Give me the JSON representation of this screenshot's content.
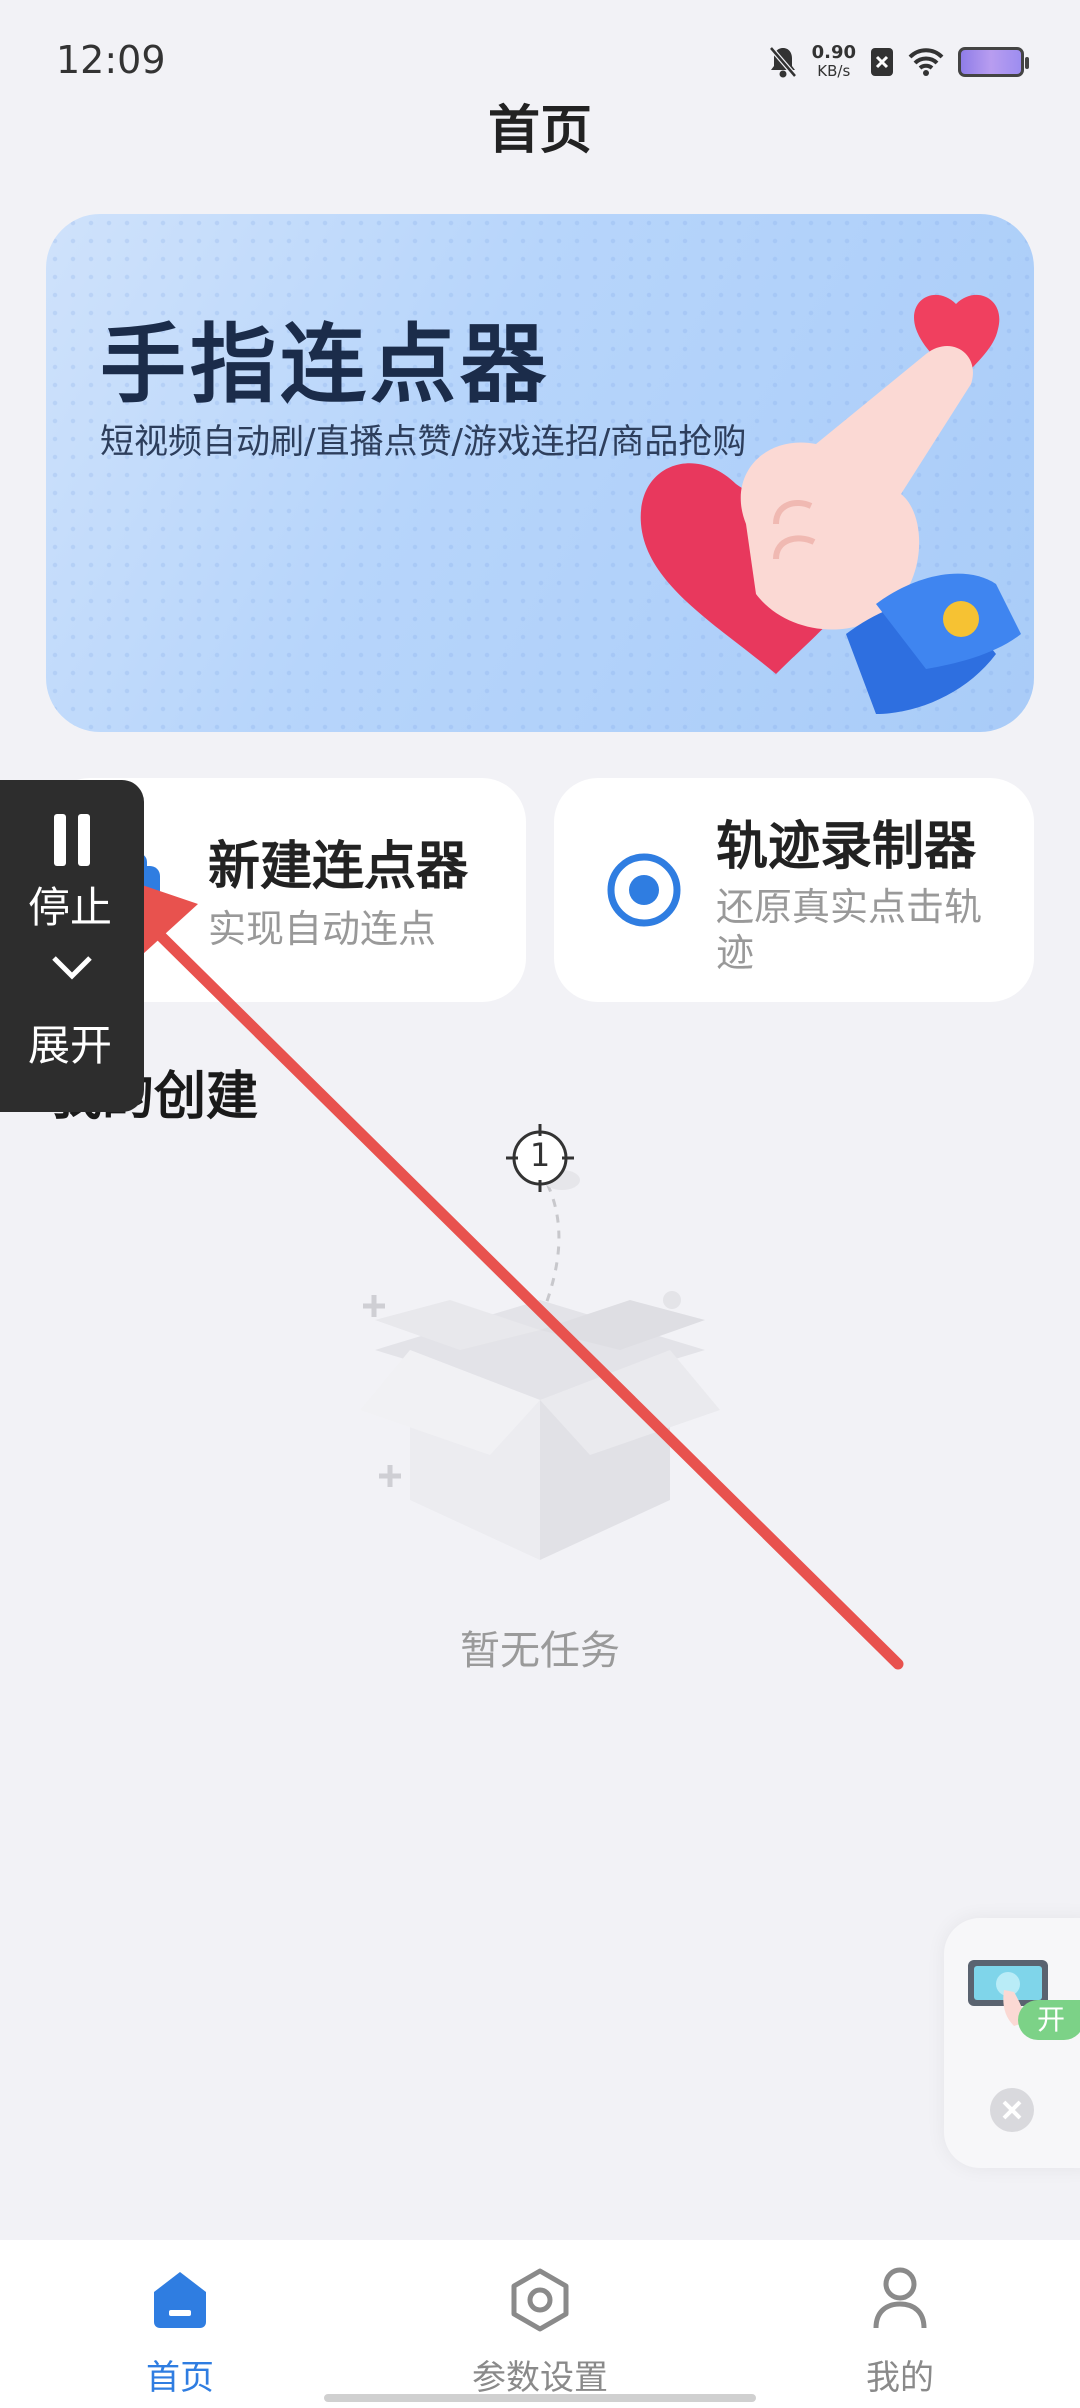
{
  "status_bar": {
    "time": "12:09",
    "net_speed_value": "0.90",
    "net_speed_unit": "KB/s"
  },
  "header": {
    "title": "首页"
  },
  "banner": {
    "title": "手指连点器",
    "subtitle": "短视频自动刷/直播点赞/游戏连招/商品抢购"
  },
  "cards": {
    "new_clicker": {
      "title": "新建连点器",
      "subtitle": "实现自动连点"
    },
    "track_recorder": {
      "title": "轨迹录制器",
      "subtitle_line1": "还原真实点击轨",
      "subtitle_line2": "迹"
    }
  },
  "section": {
    "title": "我的创建"
  },
  "empty_state": {
    "marker_number": "1",
    "text": "暂无任务"
  },
  "floating_panel": {
    "stop_label": "停止",
    "expand_label": "展开"
  },
  "side_widget": {
    "badge": "开"
  },
  "bottom_nav": {
    "items": [
      {
        "label": "首页",
        "active": true
      },
      {
        "label": "参数设置",
        "active": false
      },
      {
        "label": "我的",
        "active": false
      }
    ]
  },
  "colors": {
    "accent": "#2f7de1",
    "arrow": "#e8524e",
    "inactive": "#8a8a8a"
  }
}
